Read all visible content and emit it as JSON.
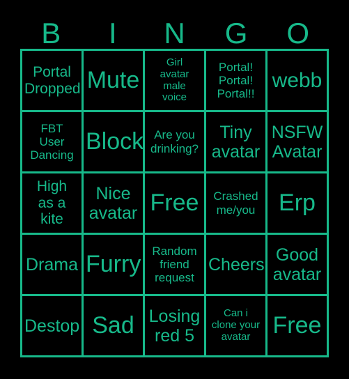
{
  "card": {
    "title": "BINGO",
    "colors": {
      "background": "#000000",
      "accent": "#17b98a",
      "text": "#17b98a",
      "grid_line": "#17b98a"
    },
    "header": {
      "letters": [
        "B",
        "I",
        "N",
        "G",
        "O"
      ]
    },
    "grid": {
      "columns": 5,
      "rows": 5,
      "cells": [
        {
          "text": "Portal\nDropped",
          "size": "sm"
        },
        {
          "text": "Mute",
          "size": "xl"
        },
        {
          "text": "Girl\navatar\nmale\nvoice",
          "size": "xxs"
        },
        {
          "text": "Portal!\nPortal!\nPortal!!",
          "size": "xs"
        },
        {
          "text": "webb",
          "size": "lg"
        },
        {
          "text": "FBT\nUser\nDancing",
          "size": "xs"
        },
        {
          "text": "Block",
          "size": "xl"
        },
        {
          "text": "Are you\ndrinking?",
          "size": "xs"
        },
        {
          "text": "Tiny\navatar",
          "size": "md"
        },
        {
          "text": "NSFW\nAvatar",
          "size": "md"
        },
        {
          "text": "High\nas a\nkite",
          "size": "sm"
        },
        {
          "text": "Nice\navatar",
          "size": "md"
        },
        {
          "text": "Free",
          "size": "xl"
        },
        {
          "text": "Crashed\nme/you",
          "size": "xs"
        },
        {
          "text": "Erp",
          "size": "xl"
        },
        {
          "text": "Drama",
          "size": "md"
        },
        {
          "text": "Furry",
          "size": "xl"
        },
        {
          "text": "Random\nfriend\nrequest",
          "size": "xs"
        },
        {
          "text": "Cheers",
          "size": "md"
        },
        {
          "text": "Good\navatar",
          "size": "md"
        },
        {
          "text": "Destop",
          "size": "md"
        },
        {
          "text": "Sad",
          "size": "xl"
        },
        {
          "text": "Losing\nred 5",
          "size": "md"
        },
        {
          "text": "Can i\nclone your\navatar",
          "size": "xxs"
        },
        {
          "text": "Free",
          "size": "xl"
        }
      ]
    }
  }
}
